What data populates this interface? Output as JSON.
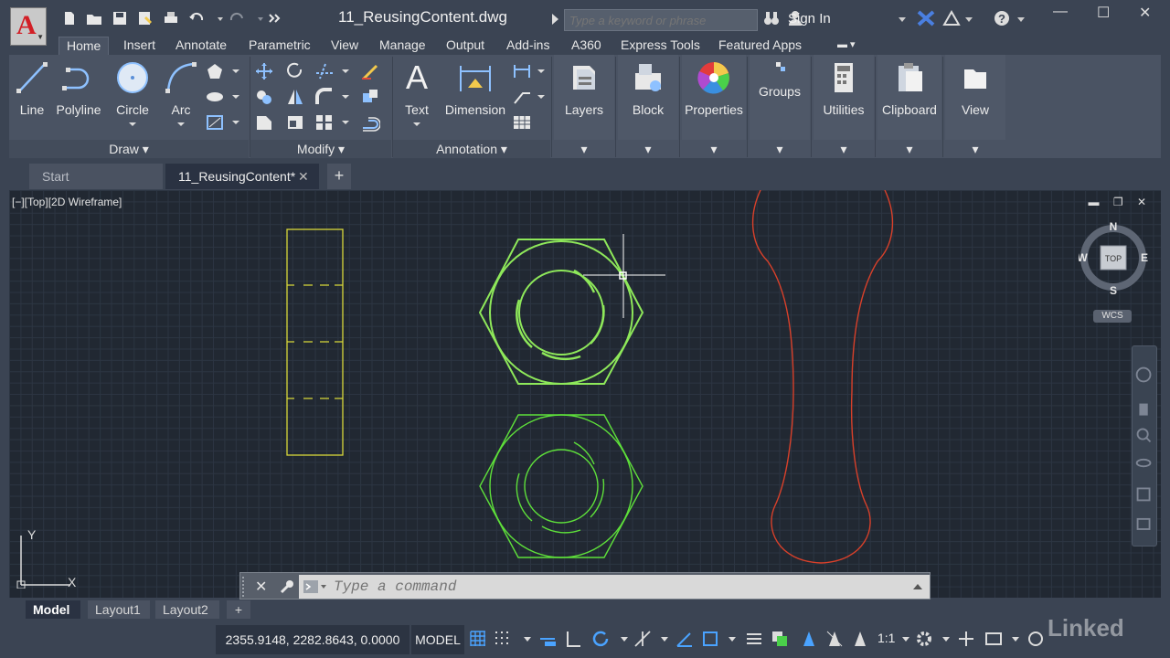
{
  "titlebar": {
    "app_icon_letter": "A",
    "document_title": "11_ReusingContent.dwg",
    "search_placeholder": "Type a keyword or phrase",
    "signin_label": "Sign In",
    "help_label": "?"
  },
  "ribbon_tabs": [
    {
      "label": "Home",
      "active": true
    },
    {
      "label": "Insert"
    },
    {
      "label": "Annotate"
    },
    {
      "label": "Parametric"
    },
    {
      "label": "View"
    },
    {
      "label": "Manage"
    },
    {
      "label": "Output"
    },
    {
      "label": "Add-ins"
    },
    {
      "label": "A360"
    },
    {
      "label": "Express Tools"
    },
    {
      "label": "Featured Apps"
    }
  ],
  "ribbon": {
    "draw": {
      "title": "Draw",
      "line": "Line",
      "polyline": "Polyline",
      "circle": "Circle",
      "arc": "Arc"
    },
    "modify": {
      "title": "Modify"
    },
    "annotation": {
      "title": "Annotation",
      "text": "Text",
      "dimension": "Dimension"
    },
    "layers": "Layers",
    "block": "Block",
    "properties": "Properties",
    "groups": "Groups",
    "utilities": "Utilities",
    "clipboard": "Clipboard",
    "view": "View"
  },
  "file_tabs": {
    "start": "Start",
    "document": "11_ReusingContent*",
    "add": "+"
  },
  "viewport": {
    "label": "[−][Top][2D Wireframe]",
    "viewcube": {
      "n": "N",
      "s": "S",
      "e": "E",
      "w": "W",
      "face": "TOP"
    },
    "wcs": "WCS",
    "ucs_y": "Y",
    "ucs_x": "X"
  },
  "command_line": {
    "placeholder": "Type a command"
  },
  "layout_tabs": [
    {
      "label": "Model",
      "active": true
    },
    {
      "label": "Layout1"
    },
    {
      "label": "Layout2"
    }
  ],
  "statusbar": {
    "coordinates": "2355.9148, 2282.8643, 0.0000",
    "model": "MODEL",
    "scale": "1:1"
  },
  "watermark": "Linked",
  "colors": {
    "bg": "#3b4453",
    "drawing_bg": "#212832",
    "yellow": "#d8d83a",
    "green": "#5ee03a",
    "red": "#d8402a"
  }
}
